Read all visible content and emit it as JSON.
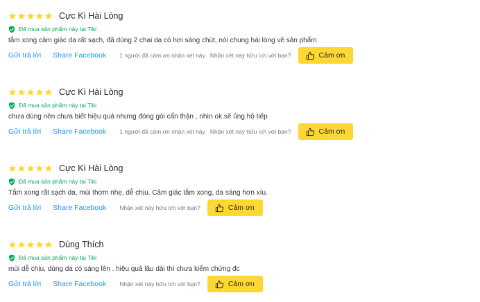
{
  "colors": {
    "star": "#fdd835",
    "verified": "#00ab56",
    "link": "#1a94ff",
    "button": "#fdd835"
  },
  "icons": {
    "rating": "star-icon",
    "verified": "shield-check-icon",
    "thanks": "thumbs-up-icon"
  },
  "common": {
    "verified_text": "Đã mua sản phẩm này tại Tiki",
    "reply_label": "Gửi trả lời",
    "share_label": "Share Facebook",
    "helpful_question": "Nhận xét này hữu ích với bạn?",
    "thanks_label": "Cảm ơn"
  },
  "reviews": [
    {
      "rating": 5,
      "title": "Cực Kì Hài Lòng",
      "content": "tắm xong cảm giác da rất sạch, đã dùng 2 chai da có hơi sáng chút, nói chung hài lòng về sản phẩm",
      "thanked_text": "1 người đã cảm ơn nhận xét này"
    },
    {
      "rating": 5,
      "title": "Cực Kì Hài Lòng",
      "content": "chưa dùng nên chưa biết hiệu quả nhưng đóng gói cẩn thận , nhìn ok.sẽ ủng hộ tiếp",
      "thanked_text": "1 người đã cảm ơn nhận xét này"
    },
    {
      "rating": 5,
      "title": "Cực Kì Hài Lòng",
      "content": "Tắm xong rất sạch da, mùi thơm nhẹ, dễ chịu. Cảm giác tắm xong, da sáng hơn xíu."
    },
    {
      "rating": 5,
      "title": "Dùng Thích",
      "content": "mùi dễ chịu, dùng da có sáng lên . hiệu quả lâu dài thì chưa kiểm chứng đc"
    }
  ]
}
